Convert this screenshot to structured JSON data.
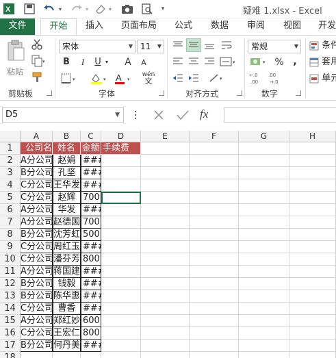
{
  "window": {
    "title": "疑难 1.xlsx - Excel"
  },
  "tabs": [
    "文件",
    "开始",
    "插入",
    "页面布局",
    "公式",
    "数据",
    "审阅",
    "视图",
    "开发"
  ],
  "ribbon": {
    "clipboard": {
      "paste": "粘贴",
      "label": "剪贴板"
    },
    "font": {
      "name": "宋体",
      "size": "11",
      "label": "字体",
      "bold": "B",
      "italic": "I",
      "underline": "U",
      "grow": "A",
      "shrink": "A",
      "wen": "wén"
    },
    "alignment": {
      "label": "对齐方式"
    },
    "number": {
      "format": "常规",
      "label": "数字",
      "percent": "%",
      "comma": "9",
      "inc": ".0 .00",
      "dec": ".00 .0"
    },
    "styles": {
      "conditional": "条件",
      "table": "套用",
      "cell": "单元"
    }
  },
  "formula_bar": {
    "name_box": "D5",
    "fx": "fx",
    "value": ""
  },
  "sheet": {
    "columns": [
      "A",
      "B",
      "C",
      "D",
      "E",
      "F",
      "G",
      "H"
    ],
    "header_row": [
      "公司名",
      "姓名",
      "金额",
      "手续费"
    ],
    "rows": [
      [
        "A分公司",
        "赵娟",
        "###"
      ],
      [
        "B分公司",
        "孔坚",
        "###"
      ],
      [
        "C分公司",
        "王华发",
        "###"
      ],
      [
        "C分公司",
        "赵辉",
        "700"
      ],
      [
        "A分公司",
        "华发",
        "###"
      ],
      [
        "A分公司",
        "赵德国",
        "700"
      ],
      [
        "B分公司",
        "沈芳虹",
        "500"
      ],
      [
        "C分公司",
        "周红玉",
        "###"
      ],
      [
        "C分公司",
        "潘芬芳",
        "800"
      ],
      [
        "A分公司",
        "蒋国建",
        "###"
      ],
      [
        "B分公司",
        "钱毅",
        "###"
      ],
      [
        "B分公司",
        "陈华惠",
        "###"
      ],
      [
        "C分公司",
        "曹香",
        "###"
      ],
      [
        "A分公司",
        "郑红妙",
        "600"
      ],
      [
        "C分公司",
        "王宏仁",
        "800"
      ],
      [
        "B分公司",
        "何丹美",
        "###"
      ]
    ],
    "row_numbers": [
      "1",
      "2",
      "3",
      "4",
      "5",
      "6",
      "7",
      "8",
      "9",
      "10",
      "11",
      "12",
      "13",
      "14",
      "15",
      "16",
      "17",
      "18"
    ]
  }
}
